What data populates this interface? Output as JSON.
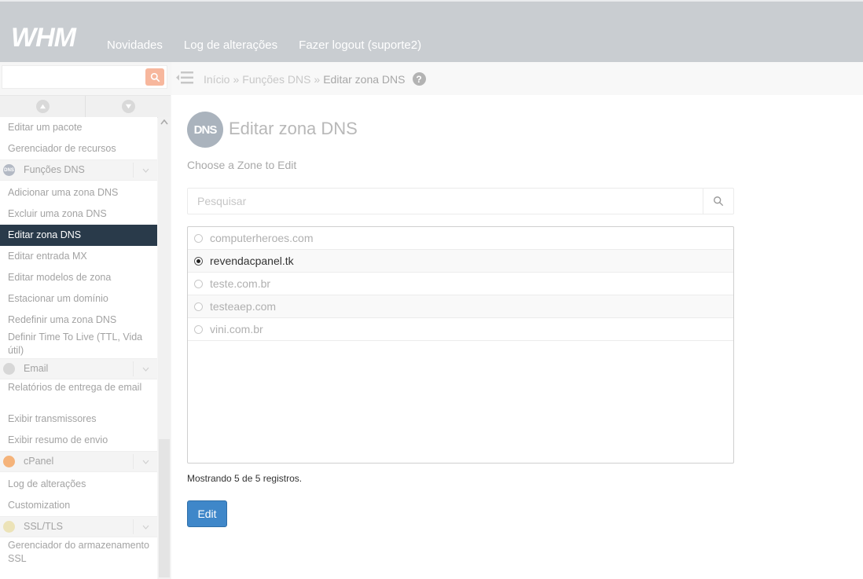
{
  "header": {
    "logo": "WHM",
    "nav": [
      "Novidades",
      "Log de alterações",
      "Fazer logout (suporte2)"
    ]
  },
  "sidebar": {
    "search_placeholder": "",
    "items": [
      {
        "type": "item",
        "label": "Editar um pacote"
      },
      {
        "type": "item",
        "label": "Gerenciador de recursos"
      },
      {
        "type": "cat",
        "label": "Funções DNS",
        "icon": "dns-icon",
        "color": "#b3b9c4"
      },
      {
        "type": "item",
        "label": "Adicionar uma zona DNS"
      },
      {
        "type": "item",
        "label": "Excluir uma zona DNS"
      },
      {
        "type": "item",
        "label": "Editar zona DNS",
        "active": true
      },
      {
        "type": "item",
        "label": "Editar entrada MX"
      },
      {
        "type": "item",
        "label": "Editar modelos de zona"
      },
      {
        "type": "item",
        "label": "Estacionar um domínio"
      },
      {
        "type": "item",
        "label": "Redefinir uma zona DNS"
      },
      {
        "type": "item",
        "label": "Definir Time To Live (TTL, Vida útil)"
      },
      {
        "type": "cat",
        "label": "Email",
        "icon": "email-icon",
        "color": "#d7d7d7"
      },
      {
        "type": "item",
        "label": "Relatórios de entrega de email"
      },
      {
        "type": "item",
        "label": "Exibir transmissores"
      },
      {
        "type": "item",
        "label": "Exibir resumo de envio"
      },
      {
        "type": "cat",
        "label": "cPanel",
        "icon": "cpanel-icon",
        "color": "#f5b37a"
      },
      {
        "type": "item",
        "label": "Log de alterações"
      },
      {
        "type": "item",
        "label": "Customization"
      },
      {
        "type": "cat",
        "label": "SSL/TLS",
        "icon": "ssl-icon",
        "color": "#ece3b8"
      },
      {
        "type": "item",
        "label": "Gerenciador do armazenamento SSL"
      }
    ]
  },
  "breadcrumb": {
    "items": [
      "Início",
      "»",
      "Funções DNS",
      "»",
      "Editar zona DNS"
    ]
  },
  "main": {
    "icon_text": "DNS",
    "title": "Editar zona DNS",
    "subtitle": "Choose a Zone to Edit",
    "search_placeholder": "Pesquisar",
    "zones": [
      {
        "name": "computerheroes.com",
        "selected": false
      },
      {
        "name": "revendacpanel.tk",
        "selected": true
      },
      {
        "name": "teste.com.br",
        "selected": false
      },
      {
        "name": "testeaep.com",
        "selected": false
      },
      {
        "name": "vini.com.br",
        "selected": false
      }
    ],
    "count_text": "Mostrando 5 de 5 registros.",
    "edit_label": "Edit"
  },
  "colors": {
    "topbar": "#c9cdd1",
    "active_item": "#293a4a",
    "primary_button": "#3f87c9",
    "search_accent": "#f7b79d"
  }
}
